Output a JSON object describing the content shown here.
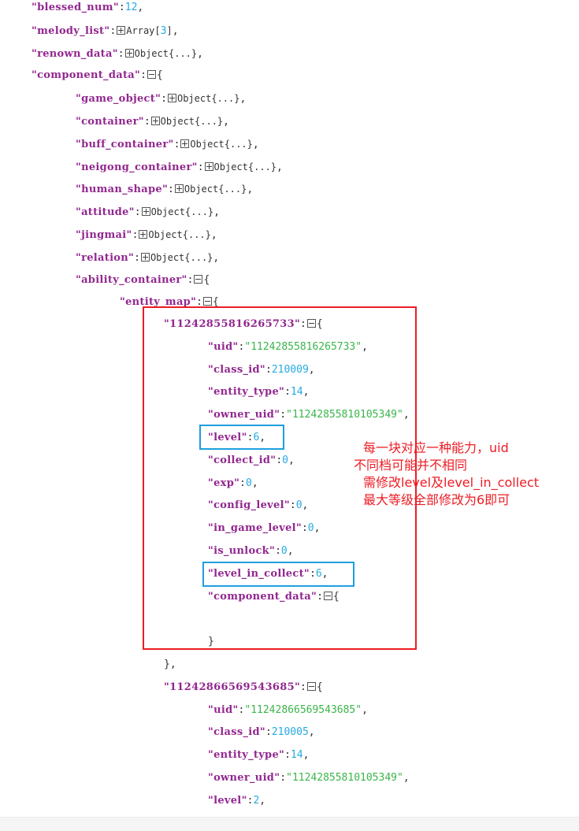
{
  "lines": [
    {
      "key": "blessed_num",
      "type": "num",
      "value": "12",
      "comma": ","
    },
    {
      "key": "melody_list",
      "type": "collapsed",
      "label": "Array[",
      "count": "3",
      "close": "]",
      "comma": ","
    },
    {
      "key": "renown_data",
      "type": "collapsed",
      "label": "Object{...}",
      "comma": ","
    },
    {
      "key": "component_data",
      "type": "open"
    },
    {
      "key": "game_object",
      "type": "collapsed",
      "label": "Object{...}",
      "comma": ","
    },
    {
      "key": "container",
      "type": "collapsed",
      "label": "Object{...}",
      "comma": ","
    },
    {
      "key": "buff_container",
      "type": "collapsed",
      "label": "Object{...}",
      "comma": ","
    },
    {
      "key": "neigong_container",
      "type": "collapsed",
      "label": "Object{...}",
      "comma": ","
    },
    {
      "key": "human_shape",
      "type": "collapsed",
      "label": "Object{...}",
      "comma": ","
    },
    {
      "key": "attitude",
      "type": "collapsed",
      "label": "Object{...}",
      "comma": ","
    },
    {
      "key": "jingmai",
      "type": "collapsed",
      "label": "Object{...}",
      "comma": ","
    },
    {
      "key": "relation",
      "type": "collapsed",
      "label": "Object{...}",
      "comma": ","
    },
    {
      "key": "ability_container",
      "type": "open"
    },
    {
      "key": "entity_map",
      "type": "open"
    }
  ],
  "entities": [
    {
      "id": "11242855816265733",
      "fields": [
        {
          "key": "uid",
          "type": "str",
          "value": "11242855816265733"
        },
        {
          "key": "class_id",
          "type": "num",
          "value": "210009"
        },
        {
          "key": "entity_type",
          "type": "num",
          "value": "14"
        },
        {
          "key": "owner_uid",
          "type": "str",
          "value": "11242855810105349"
        },
        {
          "key": "level",
          "type": "num",
          "value": "6"
        },
        {
          "key": "collect_id",
          "type": "num",
          "value": "0"
        },
        {
          "key": "exp",
          "type": "num",
          "value": "0"
        },
        {
          "key": "config_level",
          "type": "num",
          "value": "0"
        },
        {
          "key": "in_game_level",
          "type": "num",
          "value": "0"
        },
        {
          "key": "is_unlock",
          "type": "num",
          "value": "0"
        },
        {
          "key": "level_in_collect",
          "type": "num",
          "value": "6"
        },
        {
          "key": "component_data",
          "type": "open"
        }
      ],
      "close_inner": "}",
      "close_outer": "},"
    },
    {
      "id": "11242866569543685",
      "fields": [
        {
          "key": "uid",
          "type": "str",
          "value": "11242866569543685"
        },
        {
          "key": "class_id",
          "type": "num",
          "value": "210005"
        },
        {
          "key": "entity_type",
          "type": "num",
          "value": "14"
        },
        {
          "key": "owner_uid",
          "type": "str",
          "value": "11242855810105349"
        },
        {
          "key": "level",
          "type": "num",
          "value": "2"
        }
      ]
    }
  ],
  "annotation": {
    "lines": [
      "每一块对应一种能力，uid",
      "不同档可能并不相同",
      "需修改level及level_in_collect",
      "最大等级全部修改为6即可"
    ],
    "color": "#ed1c24"
  },
  "colors": {
    "key": "#92278f",
    "number": "#25aae1",
    "string": "#3ab54a",
    "highlight_box": "#1e9fdf",
    "annotation_box": "#ed1c24"
  }
}
